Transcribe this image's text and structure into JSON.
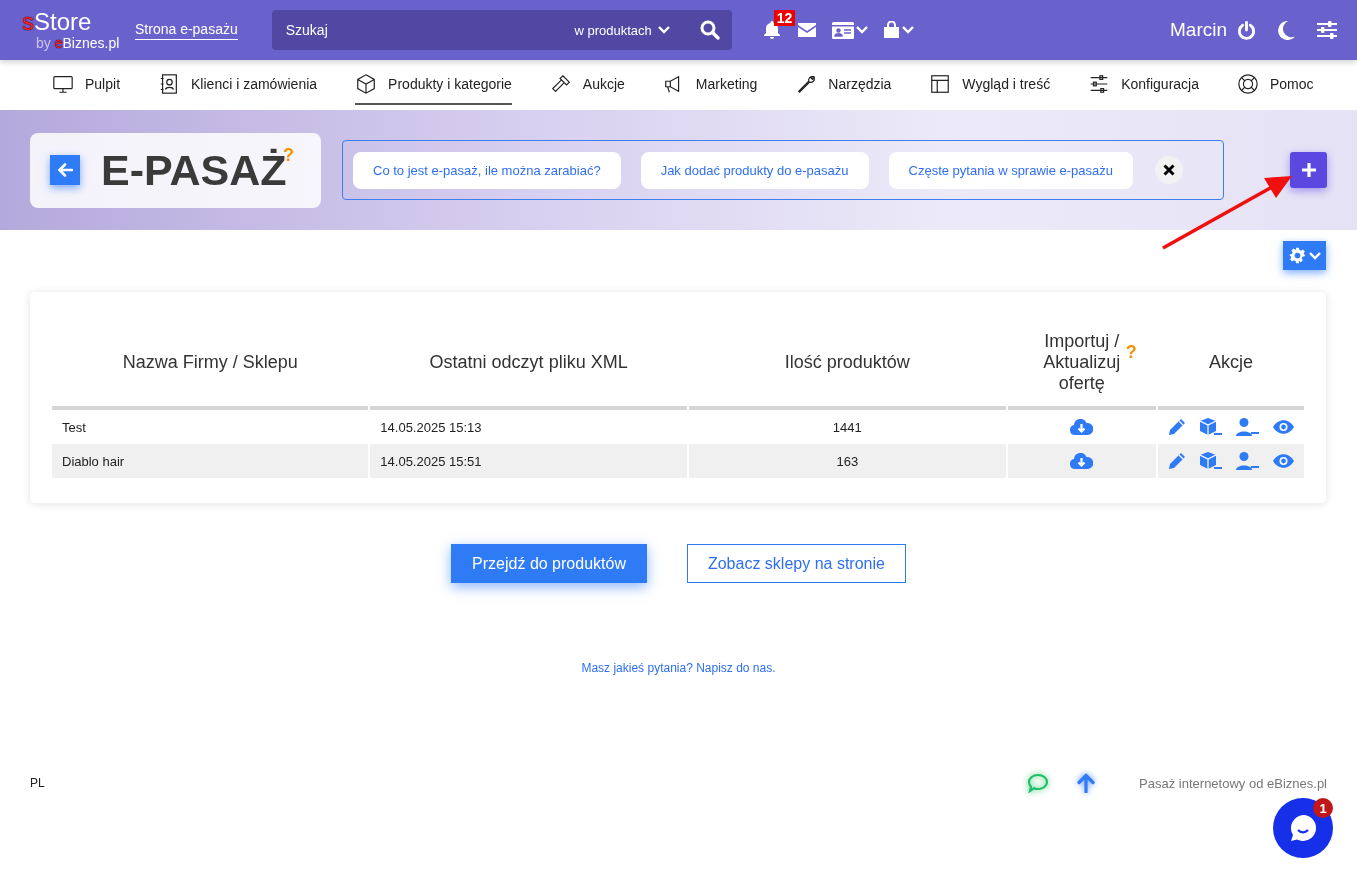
{
  "header": {
    "logo": {
      "accent": "s",
      "text": "Store"
    },
    "byline": {
      "prefix": "by ",
      "accent": "e",
      "text": "Biznes.pl"
    },
    "site_link": "Strona e-pasażu",
    "search": {
      "placeholder": "Szukaj",
      "scope": "w produktach"
    },
    "notifications_badge": "12",
    "user": "Marcin"
  },
  "nav": [
    {
      "label": "Pulpit",
      "selected": false
    },
    {
      "label": "Klienci i zamówienia",
      "selected": false
    },
    {
      "label": "Produkty i kategorie",
      "selected": true
    },
    {
      "label": "Aukcje",
      "selected": false
    },
    {
      "label": "Marketing",
      "selected": false
    },
    {
      "label": "Narzędzia",
      "selected": false
    },
    {
      "label": "Wygląd i treść",
      "selected": false
    },
    {
      "label": "Konfiguracja",
      "selected": false
    },
    {
      "label": "Pomoc",
      "selected": false
    }
  ],
  "page": {
    "title": "E-PASAŻ",
    "help_mark": "?",
    "help_links": [
      "Co to jest e-pasaż, ile można zarabiać?",
      "Jak dodać produkty do e-pasażu",
      "Częste pytania w sprawie e-pasażu"
    ]
  },
  "table": {
    "columns": [
      {
        "label": "Nazwa Firmy / Sklepu"
      },
      {
        "label": "Ostatni odczyt pliku XML"
      },
      {
        "label": "Ilość produktów"
      },
      {
        "label": "Importuj / Aktualizuj ofertę",
        "help_mark": "?"
      },
      {
        "label": "Akcje"
      }
    ],
    "rows": [
      {
        "name": "Test",
        "last_read": "14.05.2025 15:13",
        "products": "1441"
      },
      {
        "name": "Diablo hair",
        "last_read": "14.05.2025 15:51",
        "products": "163"
      }
    ]
  },
  "buttons": [
    {
      "label": "Przejdź do produktów",
      "kind": "primary"
    },
    {
      "label": "Zobacz sklepy na stronie",
      "kind": "outline"
    }
  ],
  "contact_link": "Masz jakieś pytania? Napisz do nas.",
  "footer": {
    "language": "PL",
    "credit": "Pasaż internetowy od eBiznes.pl"
  },
  "chat_badge": "1"
}
